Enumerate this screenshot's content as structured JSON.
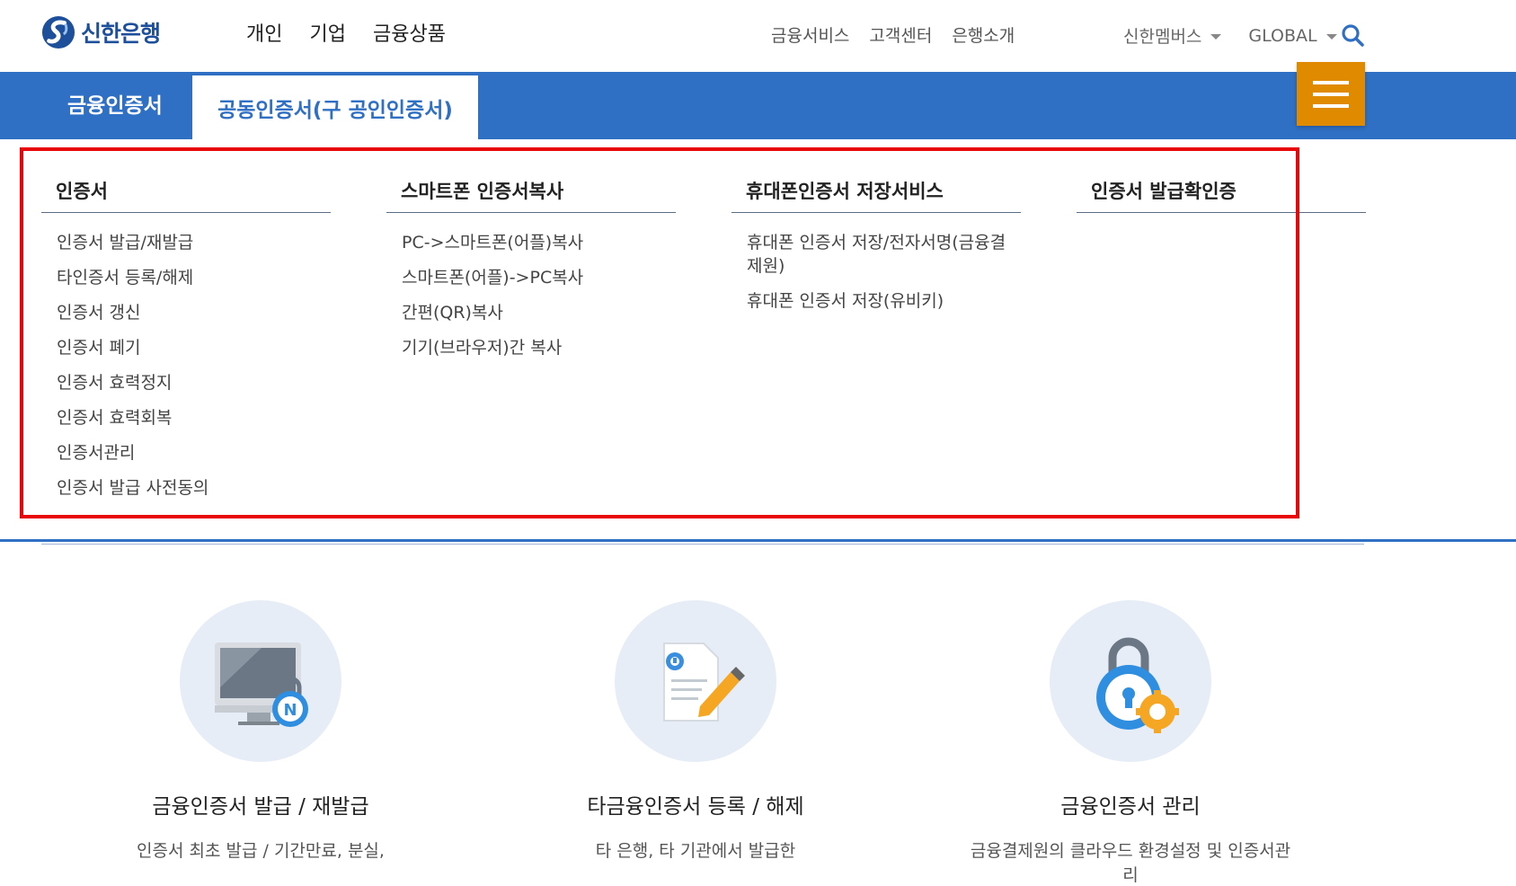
{
  "header": {
    "logo_text": "신한은행",
    "gnb": [
      "개인",
      "기업",
      "금융상품"
    ],
    "util": [
      "금융서비스",
      "고객센터",
      "은행소개"
    ],
    "member_label": "신한멤버스",
    "global_label": "GLOBAL"
  },
  "tabs": {
    "tab1": "금융인증서",
    "tab2": "공동인증서(구 공인인증서)"
  },
  "mega_menu": {
    "columns": [
      {
        "title": "인증서",
        "items": [
          "인증서 발급/재발급",
          "타인증서 등록/해제",
          "인증서 갱신",
          "인증서 폐기",
          "인증서 효력정지",
          "인증서 효력회복",
          "인증서관리",
          "인증서 발급 사전동의"
        ]
      },
      {
        "title": "스마트폰 인증서복사",
        "items": [
          "PC->스마트폰(어플)복사",
          "스마트폰(어플)->PC복사",
          "간편(QR)복사",
          "기기(브라우저)간 복사"
        ]
      },
      {
        "title": "휴대폰인증서 저장서비스",
        "items": [
          "휴대폰 인증서 저장/전자서명(금융결제원)",
          "휴대폰 인증서 저장(유비키)"
        ]
      },
      {
        "title": "인증서 발급확인증",
        "items": []
      }
    ]
  },
  "cards": [
    {
      "title": "금융인증서 발급 / 재발급",
      "desc": "인증서 최초 발급 / 기간만료, 분실,"
    },
    {
      "title": "타금융인증서 등록 / 해제",
      "desc": "타 은행, 타 기관에서 발급한"
    },
    {
      "title": "금융인증서 관리",
      "desc": "금융결제원의 클라우드 환경설정 및 인증서관리"
    }
  ],
  "colors": {
    "brand_blue": "#2f6fc4",
    "menu_orange": "#e08a00",
    "highlight_red": "#e8060a"
  },
  "icons": [
    "shinhan-logo-icon",
    "search-icon",
    "menu-icon",
    "monitor-cert-icon",
    "document-pen-icon",
    "lock-gear-icon"
  ]
}
